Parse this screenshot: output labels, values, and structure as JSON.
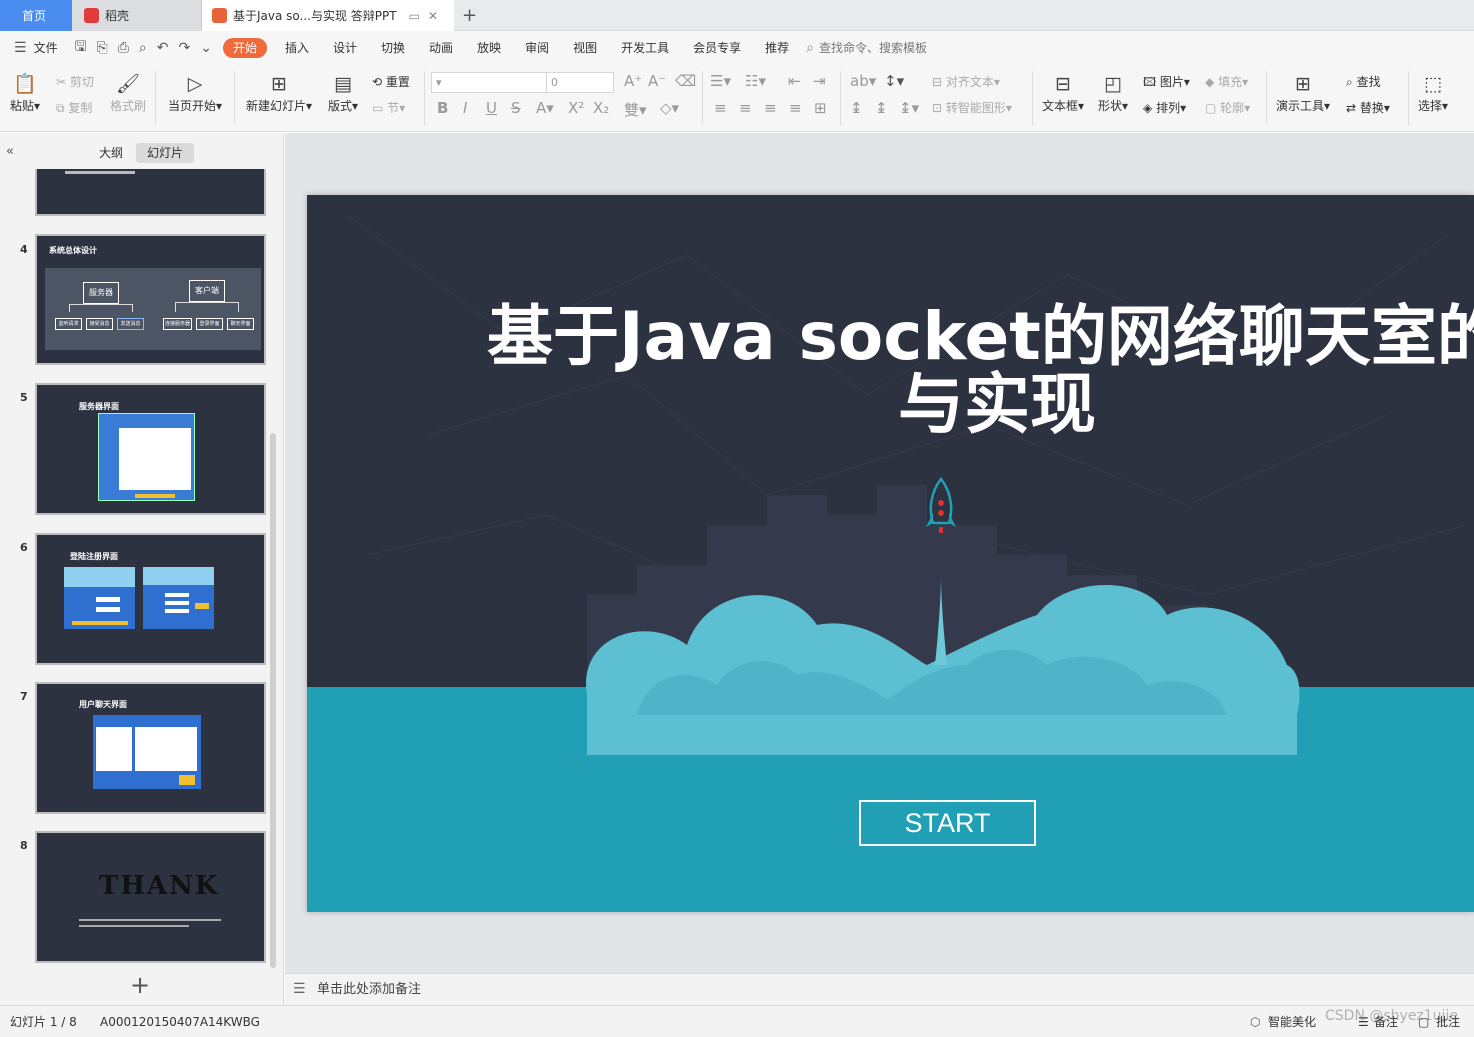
{
  "tabs": {
    "home": "首页",
    "docer": "稻壳",
    "document": "基于Java so...与实现 答辩PPT",
    "add": "+"
  },
  "menu": {
    "file": "文件",
    "items": [
      "开始",
      "插入",
      "设计",
      "切换",
      "动画",
      "放映",
      "审阅",
      "视图",
      "开发工具",
      "会员专享",
      "推荐"
    ],
    "search": "查找命令、搜索模板"
  },
  "ribbon": {
    "paste": "粘贴",
    "cut": "剪切",
    "copy": "复制",
    "format_painter": "格式刷",
    "from_current": "当页开始",
    "new_slide": "新建幻灯片",
    "layout": "版式",
    "reset": "重置",
    "section": "节",
    "font_size": "0",
    "align_text": "对齐文本",
    "smart_art": "转智能图形",
    "text_box": "文本框",
    "shape": "形状",
    "picture": "图片",
    "arrange": "排列",
    "fill": "填充",
    "outline": "轮廓",
    "presenter_tools": "演示工具",
    "find": "查找",
    "replace": "替换",
    "select": "选择"
  },
  "panel": {
    "outline_tab": "大纲",
    "slides_tab": "幻灯片",
    "add": "+",
    "thumbs": [
      {
        "num": "",
        "title": ""
      },
      {
        "num": "4",
        "title": "系统总体设计",
        "server": "服务器",
        "client": "客户端",
        "boxes": [
          "监听请求",
          "接受消息",
          "发送消息",
          "连接服务器",
          "登录界面",
          "聊天界面"
        ]
      },
      {
        "num": "5",
        "title": "服务器界面"
      },
      {
        "num": "6",
        "title": "登陆注册界面"
      },
      {
        "num": "7",
        "title": "用户聊天界面"
      },
      {
        "num": "8",
        "title": "THANK"
      }
    ]
  },
  "slide": {
    "title_line1": "基于Java socket的网络聊天室的设计",
    "title_line2": "与实现",
    "start": "START",
    "colors": {
      "bg": "#2d3241",
      "teal": "#21a0b5",
      "cloud": "#5cc0d2"
    }
  },
  "notes": {
    "placeholder": "单击此处添加备注"
  },
  "status": {
    "slide_counter": "幻灯片 1 / 8",
    "doc_id": "A000120150407A14KWBG",
    "beautify": "智能美化",
    "notes": "备注",
    "comments": "批注",
    "watermark": "CSDN @shyez1ujie"
  }
}
